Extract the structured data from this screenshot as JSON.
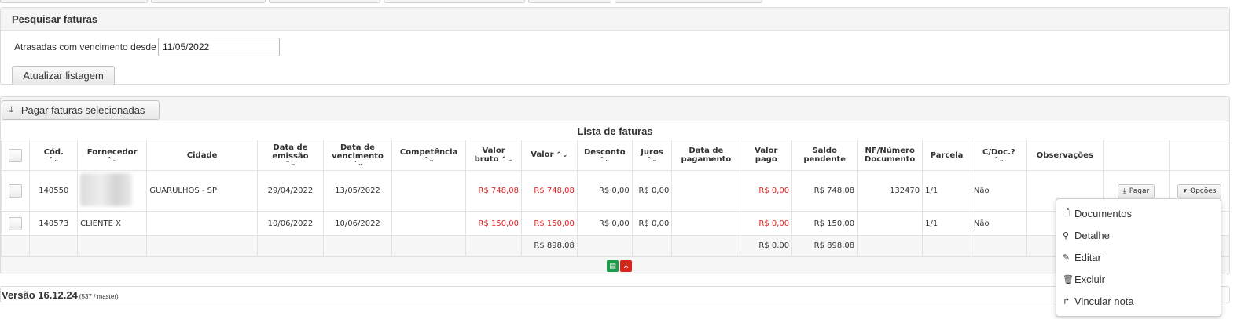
{
  "search": {
    "title": "Pesquisar faturas",
    "filter_label": "Atrasadas com vencimento desde",
    "filter_value": "11/05/2022",
    "refresh_label": "Atualizar listagem"
  },
  "list": {
    "pay_selected_label": "Pagar faturas selecionadas",
    "title": "Lista de faturas",
    "columns": {
      "cod": "Cód.",
      "fornecedor": "Fornecedor",
      "cidade": "Cidade",
      "emissao": "Data de emissão",
      "vencimento": "Data de vencimento",
      "competencia": "Competência",
      "valor_bruto": "Valor bruto",
      "valor": "Valor",
      "desconto": "Desconto",
      "juros": "Juros",
      "pagamento": "Data de pagamento",
      "valor_pago": "Valor pago",
      "saldo": "Saldo pendente",
      "nf": "NF/Número Documento",
      "parcela": "Parcela",
      "cdoc": "C/Doc.?",
      "obs": "Observações"
    },
    "rows": [
      {
        "cod": "140550",
        "fornecedor": "",
        "cidade": "GUARULHOS - SP",
        "emissao": "29/04/2022",
        "vencimento": "13/05/2022",
        "competencia": "",
        "valor_bruto": "R$ 748,08",
        "valor": "R$ 748,08",
        "desconto": "R$ 0,00",
        "juros": "R$ 0,00",
        "pagamento": "",
        "valor_pago": "R$ 0,00",
        "saldo": "R$ 748,08",
        "nf": "132470",
        "parcela": "1/1",
        "cdoc": "Não",
        "obs": "",
        "pay_label": "Pagar",
        "options_label": "Opções"
      },
      {
        "cod": "140573",
        "fornecedor": "CLIENTE X",
        "cidade": "",
        "emissao": "10/06/2022",
        "vencimento": "10/06/2022",
        "competencia": "",
        "valor_bruto": "R$ 150,00",
        "valor": "R$ 150,00",
        "desconto": "R$ 0,00",
        "juros": "R$ 0,00",
        "pagamento": "",
        "valor_pago": "R$ 0,00",
        "saldo": "R$ 150,00",
        "nf": "",
        "parcela": "1/1",
        "cdoc": "Não",
        "obs": ""
      }
    ],
    "totals": {
      "valor": "R$ 898,08",
      "valor_pago": "R$ 0,00",
      "saldo": "R$ 898,08"
    }
  },
  "options_menu": {
    "items": [
      "Documentos",
      "Detalhe",
      "Editar",
      "Excluir",
      "Vincular nota"
    ],
    "icons": [
      "document-icon",
      "magnifier-icon",
      "pencil-icon",
      "trash-icon",
      "link-arrow-icon"
    ]
  },
  "version": {
    "main": "Versão 16.12.24",
    "sub": "(537 / master)"
  },
  "colors": {
    "negative_amount": "#e02020",
    "excel_export": "#1f9a4a",
    "pdf_export": "#d4261b"
  }
}
